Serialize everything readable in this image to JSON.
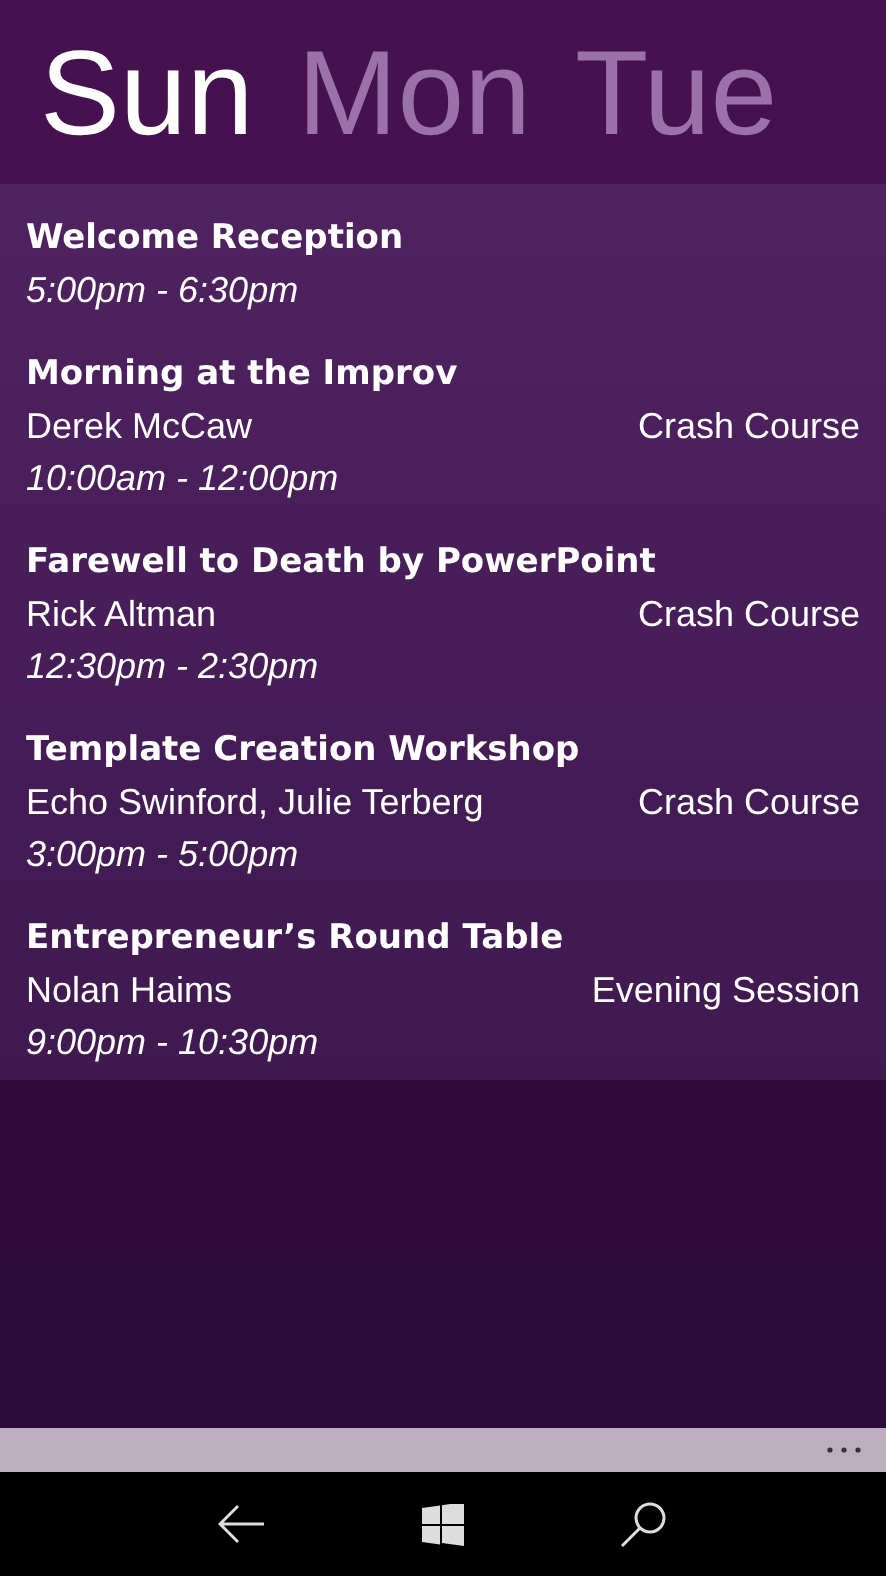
{
  "tabs": [
    {
      "label": "Sun",
      "selected": true
    },
    {
      "label": "Mon",
      "selected": false
    },
    {
      "label": "Tue",
      "selected": false
    }
  ],
  "sessions": [
    {
      "title": "Welcome Reception",
      "time": "5:00pm - 6:30pm"
    },
    {
      "title": "Morning at the Improv",
      "speaker": "Derek McCaw",
      "track": "Crash Course",
      "time": "10:00am - 12:00pm"
    },
    {
      "title": "Farewell to Death by PowerPoint",
      "speaker": "Rick Altman",
      "track": "Crash Course",
      "time": "12:30pm - 2:30pm"
    },
    {
      "title": "Template Creation Workshop",
      "speaker": "Echo Swinford, Julie Terberg",
      "track": "Crash Course",
      "time": "3:00pm - 5:00pm"
    },
    {
      "title": "Entrepreneur’s Round Table",
      "speaker": "Nolan Haims",
      "track": "Evening Session",
      "time": "9:00pm - 10:30pm"
    }
  ]
}
